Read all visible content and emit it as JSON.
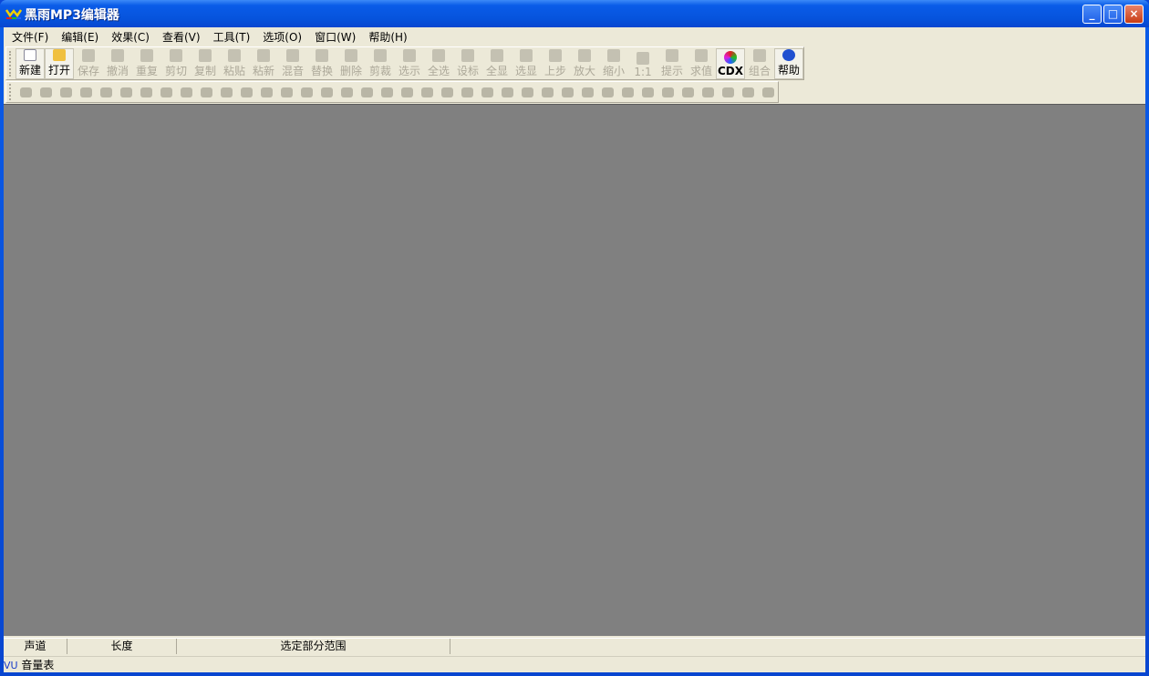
{
  "window": {
    "title": "黑雨MP3编辑器",
    "minimize": "_",
    "maximize": "□",
    "close": "×"
  },
  "menu": [
    "文件(F)",
    "编辑(E)",
    "效果(C)",
    "查看(V)",
    "工具(T)",
    "选项(O)",
    "窗口(W)",
    "帮助(H)"
  ],
  "toolbar": [
    {
      "label": "新建",
      "icon": "new-file-icon",
      "enabled": true
    },
    {
      "label": "打开",
      "icon": "open-folder-icon",
      "enabled": true
    },
    {
      "label": "保存",
      "icon": "save-icon",
      "enabled": false
    },
    {
      "label": "撤消",
      "icon": "undo-icon",
      "enabled": false
    },
    {
      "label": "重复",
      "icon": "redo-icon",
      "enabled": false
    },
    {
      "label": "剪切",
      "icon": "cut-icon",
      "enabled": false
    },
    {
      "label": "复制",
      "icon": "copy-icon",
      "enabled": false
    },
    {
      "label": "粘贴",
      "icon": "paste-icon",
      "enabled": false
    },
    {
      "label": "粘新",
      "icon": "paste-new-icon",
      "enabled": false
    },
    {
      "label": "混音",
      "icon": "mix-icon",
      "enabled": false
    },
    {
      "label": "替换",
      "icon": "replace-icon",
      "enabled": false
    },
    {
      "label": "删除",
      "icon": "delete-icon",
      "enabled": false
    },
    {
      "label": "剪裁",
      "icon": "trim-icon",
      "enabled": false
    },
    {
      "label": "选示",
      "icon": "show-selection-icon",
      "enabled": false
    },
    {
      "label": "全选",
      "icon": "select-all-icon",
      "enabled": false
    },
    {
      "label": "设标",
      "icon": "set-marker-icon",
      "enabled": false
    },
    {
      "label": "全显",
      "icon": "zoom-all-icon",
      "enabled": false
    },
    {
      "label": "选显",
      "icon": "zoom-selection-icon",
      "enabled": false
    },
    {
      "label": "上步",
      "icon": "zoom-previous-icon",
      "enabled": false
    },
    {
      "label": "放大",
      "icon": "zoom-in-icon",
      "enabled": false
    },
    {
      "label": "缩小",
      "icon": "zoom-out-icon",
      "enabled": false
    },
    {
      "label": "1:1",
      "icon": "zoom-1-1-icon",
      "enabled": false
    },
    {
      "label": "提示",
      "icon": "hint-icon",
      "enabled": false
    },
    {
      "label": "求值",
      "icon": "evaluate-icon",
      "enabled": false
    },
    {
      "label": "CDX",
      "icon": "cdx-icon",
      "enabled": true
    },
    {
      "label": "组合",
      "icon": "combine-icon",
      "enabled": false
    },
    {
      "label": "帮助",
      "icon": "help-icon",
      "enabled": true
    }
  ],
  "effects_toolbar_count": 38,
  "status": {
    "channel": "声道",
    "length": "长度",
    "selection": "选定部分范围",
    "vu": "VU",
    "vu_label": "音量表"
  }
}
